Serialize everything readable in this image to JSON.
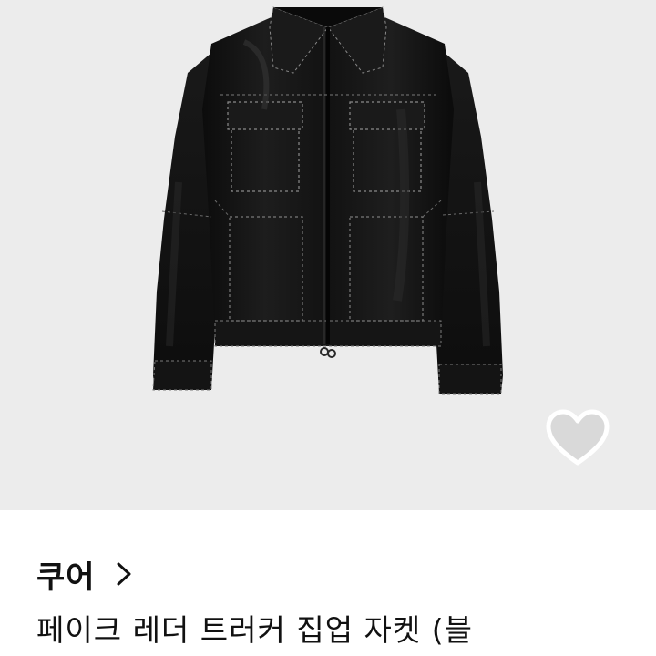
{
  "product": {
    "image_alt": "faux leather trucker zip-up jacket, black",
    "background_color": "#ececec",
    "garment_color": "#141414"
  },
  "wishlist": {
    "icon": "heart-outline-icon",
    "state": "not-liked"
  },
  "shop": {
    "name": "쿠어",
    "chevron_icon": "chevron-right-icon"
  },
  "title": "페이크 레더 트러커 집업 자켓 (블"
}
